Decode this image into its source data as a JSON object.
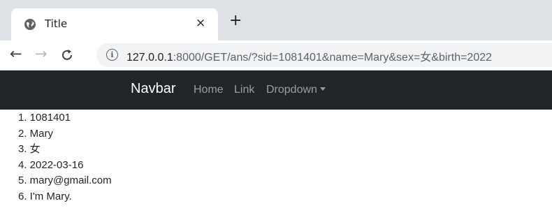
{
  "browser": {
    "tab": {
      "title": "Title",
      "favicon": "globe-icon",
      "close_glyph": "×"
    },
    "new_tab_glyph": "+",
    "nav": {
      "back_glyph": "←",
      "forward_glyph": "→",
      "reload_glyph": "C"
    },
    "address": {
      "info_glyph": "i",
      "host": "127.0.0.1",
      "rest": ":8000/GET/ans/?sid=1081401&name=Mary&sex=女&birth=2022"
    }
  },
  "navbar": {
    "brand": "Navbar",
    "links": [
      "Home",
      "Link",
      "Dropdown"
    ],
    "bg_color": "#212529"
  },
  "content": {
    "items": [
      "1. 1081401",
      "2. Mary",
      "3. 女",
      "4. 2022-03-16",
      "5. mary@gmail.com",
      "6. I'm Mary."
    ]
  }
}
